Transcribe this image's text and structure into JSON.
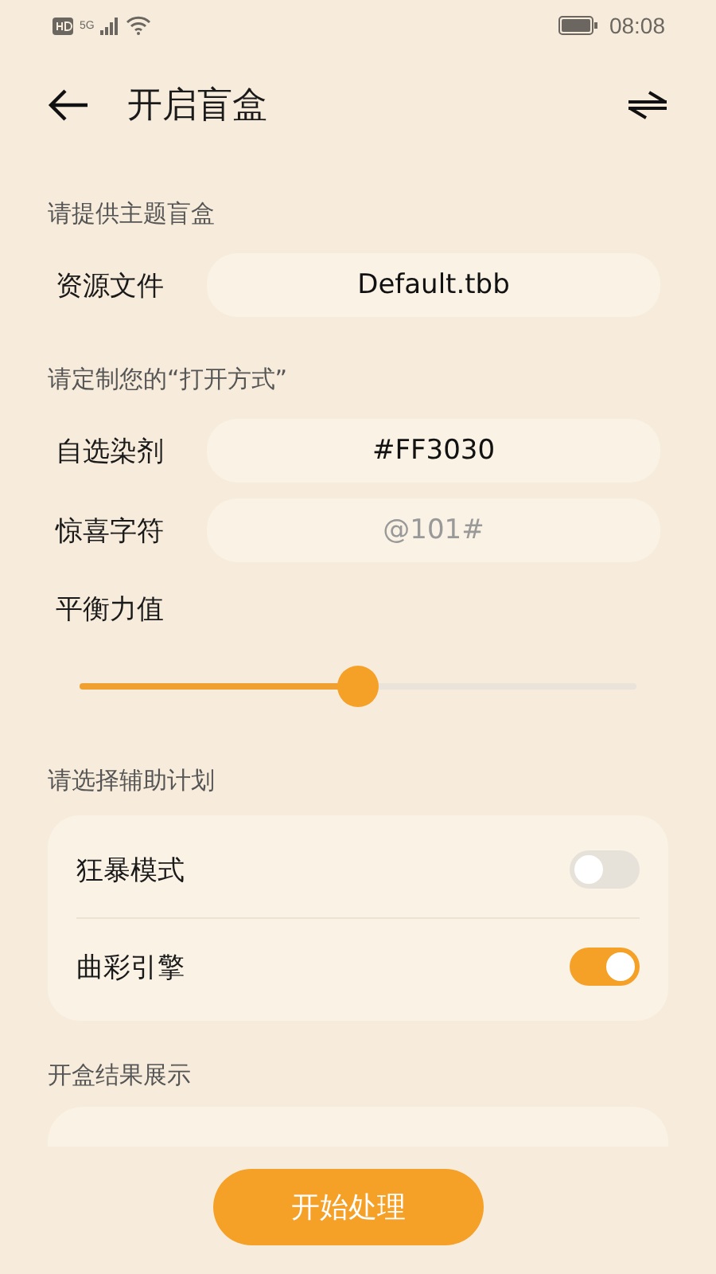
{
  "status_bar": {
    "time": "08:08",
    "network": "5G"
  },
  "header": {
    "title": "开启盲盒"
  },
  "sections": [
    {
      "heading": "请提供主题盲盒",
      "rows": [
        {
          "kind": "field",
          "label": "资源文件",
          "value": "Default.tbb"
        }
      ]
    },
    {
      "heading": "请定制您的“打开方式”",
      "rows": [
        {
          "kind": "field",
          "label": "自选染剂",
          "value": "#FF3030"
        },
        {
          "kind": "field",
          "label": "惊喜字符",
          "placeholder": "@101#"
        },
        {
          "kind": "slider",
          "label": "平衡力值",
          "level": 0.5
        }
      ]
    }
  ],
  "plan": {
    "heading": "请选择辅助计划",
    "switches": [
      {
        "label": "狂暴模式",
        "on": false
      },
      {
        "label": "曲彩引擎",
        "on": true
      }
    ]
  },
  "result": {
    "heading": "开盒结果展示"
  },
  "action_button": "开始处理"
}
